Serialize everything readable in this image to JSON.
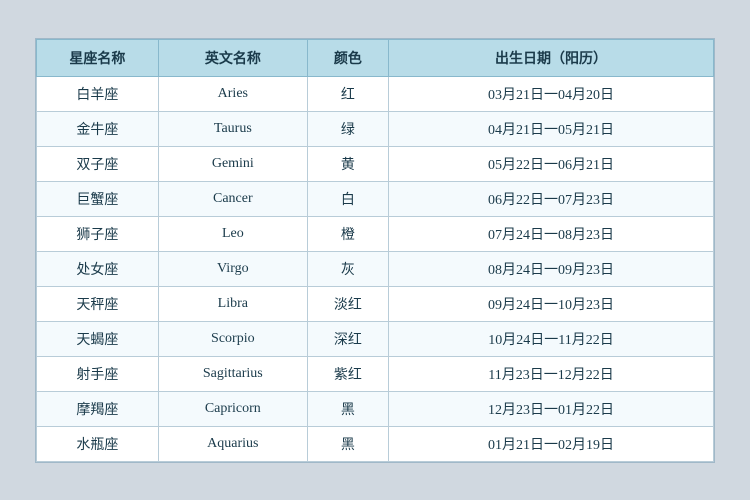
{
  "table": {
    "headers": [
      "星座名称",
      "英文名称",
      "颜色",
      "出生日期（阳历）"
    ],
    "rows": [
      {
        "zh": "白羊座",
        "en": "Aries",
        "color": "红",
        "date": "03月21日一04月20日"
      },
      {
        "zh": "金牛座",
        "en": "Taurus",
        "color": "绿",
        "date": "04月21日一05月21日"
      },
      {
        "zh": "双子座",
        "en": "Gemini",
        "color": "黄",
        "date": "05月22日一06月21日"
      },
      {
        "zh": "巨蟹座",
        "en": "Cancer",
        "color": "白",
        "date": "06月22日一07月23日"
      },
      {
        "zh": "狮子座",
        "en": "Leo",
        "color": "橙",
        "date": "07月24日一08月23日"
      },
      {
        "zh": "处女座",
        "en": "Virgo",
        "color": "灰",
        "date": "08月24日一09月23日"
      },
      {
        "zh": "天秤座",
        "en": "Libra",
        "color": "淡红",
        "date": "09月24日一10月23日"
      },
      {
        "zh": "天蝎座",
        "en": "Scorpio",
        "color": "深红",
        "date": "10月24日一11月22日"
      },
      {
        "zh": "射手座",
        "en": "Sagittarius",
        "color": "紫红",
        "date": "11月23日一12月22日"
      },
      {
        "zh": "摩羯座",
        "en": "Capricorn",
        "color": "黑",
        "date": "12月23日一01月22日"
      },
      {
        "zh": "水瓶座",
        "en": "Aquarius",
        "color": "黑",
        "date": "01月21日一02月19日"
      }
    ]
  }
}
